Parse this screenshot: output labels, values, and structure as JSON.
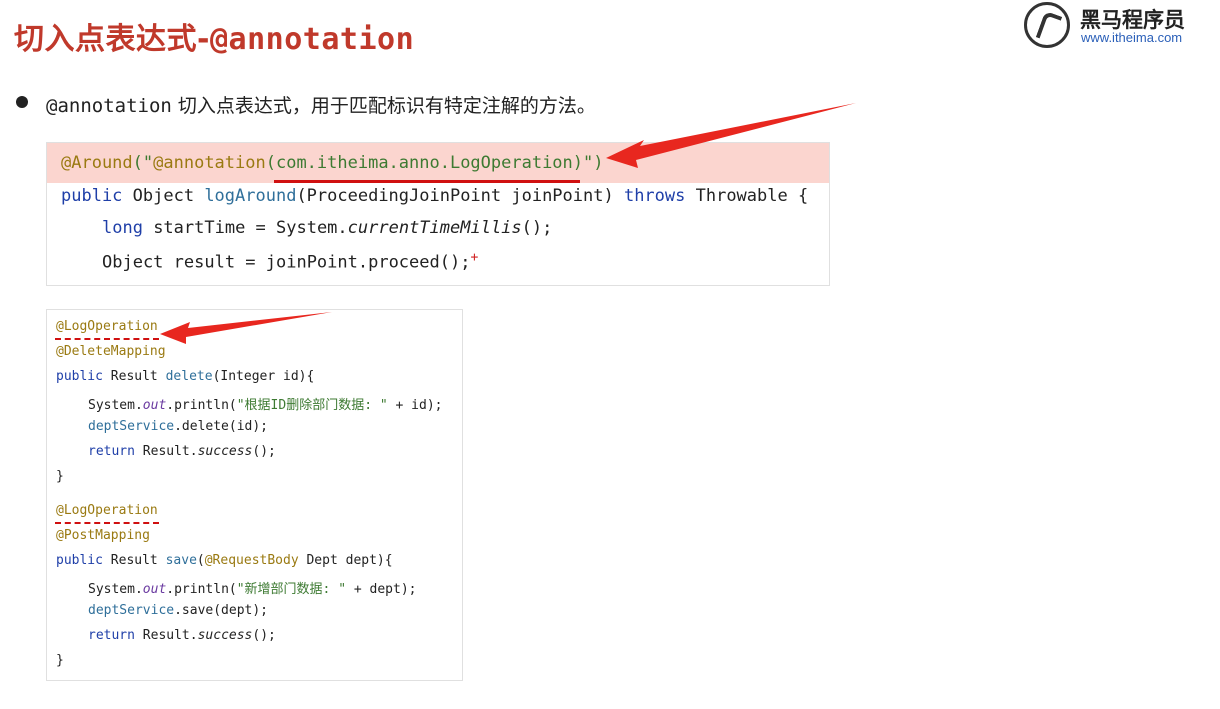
{
  "title": {
    "cn": "切入点表达式-",
    "code": "@annotation"
  },
  "logo": {
    "name": "黑马程序员",
    "url": "www.itheima.com"
  },
  "bullet": {
    "code": "@annotation",
    "text": " 切入点表达式，用于匹配标识有特定注解的方法。"
  },
  "snippet1": {
    "line1": {
      "a": "@Around",
      "b": "(\"",
      "c": "@annotation",
      "d": "(com.itheima.anno.LogOperation)",
      "e": "\")"
    },
    "line2": {
      "a": "public",
      "b": " Object ",
      "c": "logAround",
      "d": "(ProceedingJoinPoint joinPoint) ",
      "e": "throws",
      "f": " Throwable {"
    },
    "line3": {
      "a": "long",
      "b": " startTime = System.",
      "c": "currentTimeMillis",
      "d": "();"
    },
    "line4": {
      "a": "Object result = joinPoint.proceed();",
      "b": "+"
    }
  },
  "snippet2": {
    "l1": "@LogOperation",
    "l2": "@DeleteMapping",
    "l3": {
      "a": "public",
      "b": " Result ",
      "c": "delete",
      "d": "(Integer id){"
    },
    "l4": {
      "a": "System.",
      "b": "out",
      "c": ".println(",
      "d": "\"根据ID删除部门数据: \"",
      "e": " + id);"
    },
    "l5": {
      "a": "deptService",
      "b": ".delete(id);"
    },
    "l6": {
      "a": "return",
      "b": " Result.",
      "c": "success",
      "d": "();"
    },
    "l7": "}",
    "l8": "@LogOperation",
    "l9": "@PostMapping",
    "l10": {
      "a": "public",
      "b": " Result ",
      "c": "save",
      "d": "(",
      "e": "@RequestBody",
      "f": " Dept dept){"
    },
    "l11": {
      "a": "System.",
      "b": "out",
      "c": ".println(",
      "d": "\"新增部门数据: \"",
      "e": " + dept);"
    },
    "l12": {
      "a": "deptService",
      "b": ".save(dept);"
    },
    "l13": {
      "a": "return",
      "b": " Result.",
      "c": "success",
      "d": "();"
    },
    "l14": "}"
  },
  "colors": {
    "title": "#c0392b",
    "highlight": "#fbd5cf",
    "arrow": "#e8271f",
    "annotation": "#9a7a12",
    "keyword": "#1f3fa8"
  }
}
